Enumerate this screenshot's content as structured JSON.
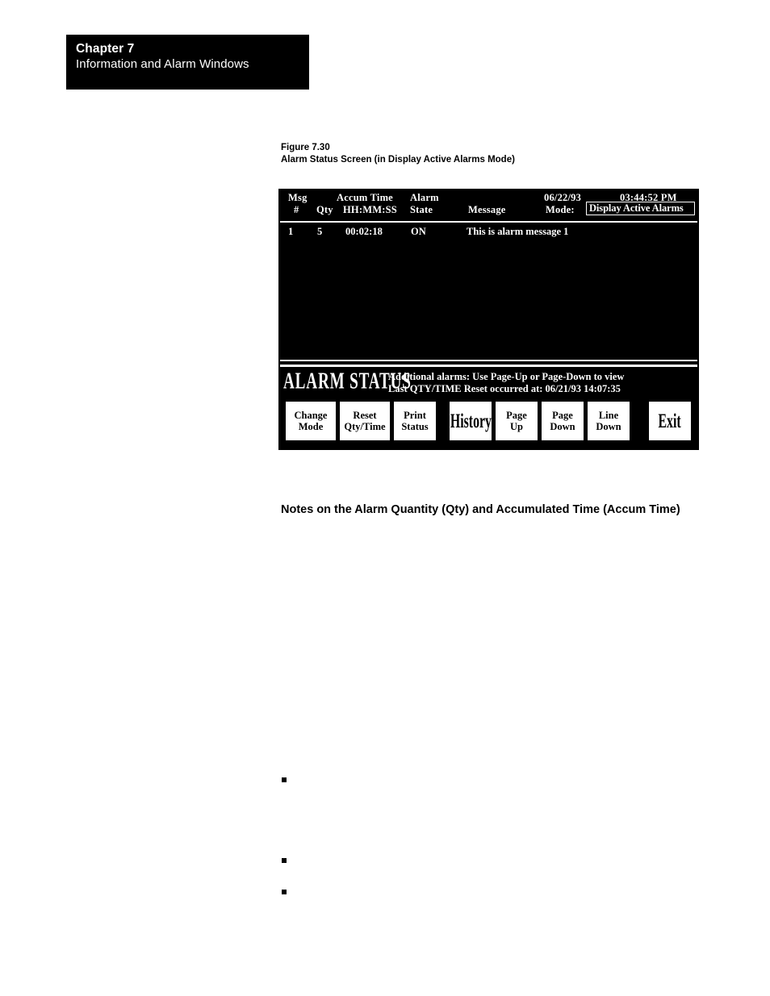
{
  "page": {
    "chapter_label": "Chapter 7",
    "chapter_title": "Information and Alarm Windows",
    "figure_number": "Figure 7.30",
    "figure_title": "Alarm Status Screen (in Display Active Alarms Mode)",
    "notes_heading": "Notes on the Alarm Quantity (Qty) and Accumulated Time (Accum Time)"
  },
  "alarm_screen": {
    "header": {
      "msg": "Msg",
      "hash": "#",
      "qty": "Qty",
      "accum_time": "Accum Time",
      "hhmmss": "HH:MM:SS",
      "alarm": "Alarm",
      "state": "State",
      "message": "Message",
      "date": "06/22/93",
      "time": "03:44:52 PM",
      "mode_label": "Mode:",
      "mode_value": "Display Active Alarms"
    },
    "rows": [
      {
        "msg_num": "1",
        "qty": "5",
        "accum_time": "00:02:18",
        "state": "ON",
        "message": "This is alarm message 1"
      }
    ],
    "status": {
      "logo": "ALARM STATUS",
      "line1": "Additional alarms:  Use Page-Up or Page-Down to view",
      "line2": "Last QTY/TIME Reset occurred at:  06/21/93 14:07:35"
    },
    "buttons": {
      "change_mode_l1": "Change",
      "change_mode_l2": "Mode",
      "reset_l1": "Reset",
      "reset_l2": "Qty/Time",
      "print_l1": "Print",
      "print_l2": "Status",
      "history": "History",
      "page_up_l1": "Page",
      "page_up_l2": "Up",
      "page_down_l1": "Page",
      "page_down_l2": "Down",
      "line_down_l1": "Line",
      "line_down_l2": "Down",
      "exit": "Exit"
    }
  },
  "colors": {
    "screen_bg": "#000000",
    "screen_fg": "#ffffff",
    "button_bg": "#ffffff",
    "button_fg": "#000000",
    "page_bg": "#ffffff"
  }
}
